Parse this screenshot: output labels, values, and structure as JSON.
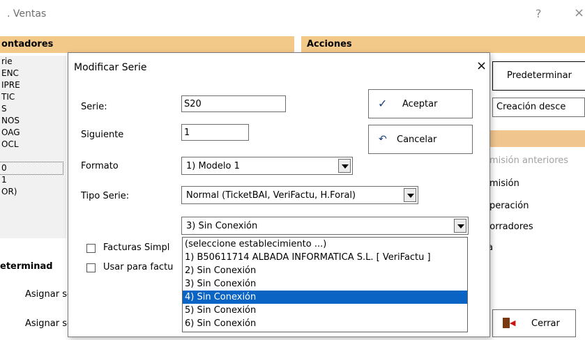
{
  "window": {
    "title": ". Ventas",
    "help": "?",
    "close": "×"
  },
  "left_panel": {
    "header": "ontadores",
    "items": [
      "rie",
      "ENC",
      "IPRE",
      "TIC",
      "S",
      "NOS",
      "OAG",
      "OCL",
      "",
      "0",
      "1",
      "OR)"
    ]
  },
  "acciones": {
    "header": "Acciones",
    "predeterminar": "Predeterminar",
    "creacion_select": "Creación desce",
    "lines": [
      "emisión anteriores",
      "emisión",
      "operación",
      "borradores",
      "ta"
    ]
  },
  "bottom": {
    "header": "eterminad",
    "row1": "Asignar serie al crear Agencia",
    "row2": "Asignar serie al crear Empres",
    "cerrar": "Cerrar"
  },
  "dialog": {
    "title": "Modificar Serie",
    "close": "×",
    "serie_label": "Serie:",
    "serie_value": "S20",
    "siguiente_label": "Siguiente",
    "siguiente_value": "1",
    "formato_label": "Formato",
    "formato_value": "1) Modelo 1",
    "tipo_label": "Tipo Serie:",
    "tipo_value": "Normal (TicketBAI, VeriFactu, H.Foral)",
    "establecimiento_value": "3) Sin Conexión",
    "aceptar": "Aceptar",
    "cancelar": "Cancelar",
    "chk1": "Facturas Simpl",
    "chk2": "Usar para factu"
  },
  "dropdown": {
    "options": [
      "(seleccione establecimiento ...)",
      "1) B50611714 ALBADA INFORMATICA S.L. [ VeriFactu ]",
      "2) Sin Conexión",
      "3) Sin Conexión",
      "4) Sin Conexión",
      "5) Sin Conexión",
      "6) Sin Conexión"
    ],
    "highlighted_index": 4
  },
  "colors": {
    "accent_header": "#f3c98a",
    "highlight": "#0a64c4"
  }
}
